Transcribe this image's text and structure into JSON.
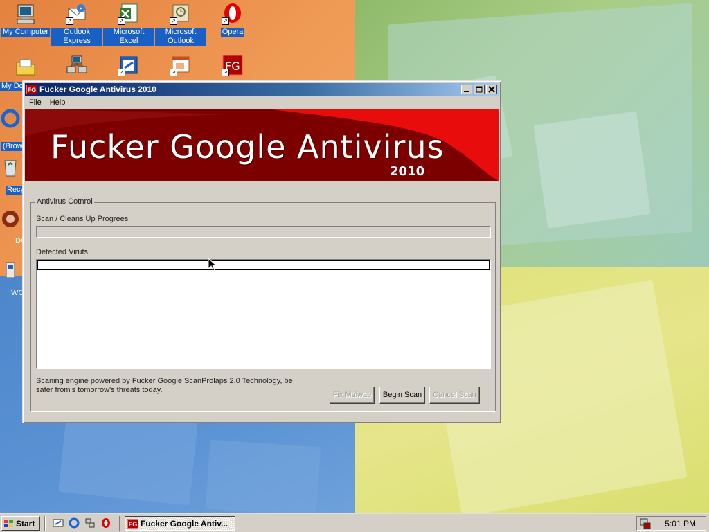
{
  "desktop": {
    "icons": [
      {
        "label": "My Computer"
      },
      {
        "label": "Outlook Express"
      },
      {
        "label": "Microsoft Excel"
      },
      {
        "label": "Microsoft Outlook"
      },
      {
        "label": "Opera"
      },
      {
        "label": "My Do"
      },
      {
        "label": "(Brow"
      },
      {
        "label": "Recy"
      },
      {
        "label": "DC"
      },
      {
        "label": "WC"
      }
    ]
  },
  "window": {
    "title": "Fucker Google Antivirus 2010",
    "icon_text": "FG",
    "menu": [
      "File",
      "Help"
    ],
    "banner": {
      "title": "Fucker Google Antivirus",
      "year": "2010"
    },
    "group_label": "Antivirus Cotnrol",
    "progress_label": "Scan / Cleans Up Progrees",
    "progress_value": 0,
    "detected_label": "Detected Viruts",
    "detected_items": [],
    "footer_text": "Scaning engine powered by Fucker Google ScanProlaps 2.0 Technology, be safer from's tomorrow's threats today.",
    "buttons": {
      "fix": "Fix Malwae",
      "begin": "Begin Scan",
      "cancel": "Cancel Scan"
    }
  },
  "taskbar": {
    "start_label": "Start",
    "task_label": "Fucker Google Antiv...",
    "clock": "5:01 PM"
  }
}
